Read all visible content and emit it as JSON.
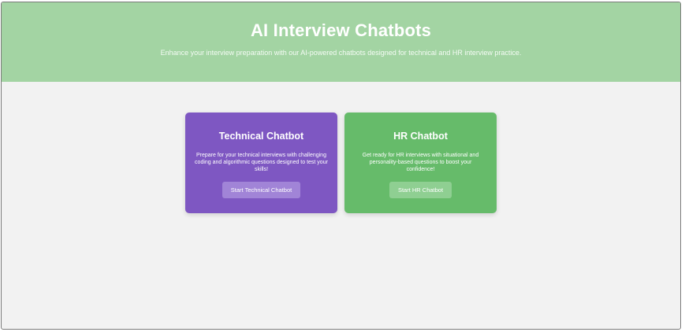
{
  "header": {
    "title": "AI Interview Chatbots",
    "subtitle": "Enhance your interview preparation with our AI-powered chatbots designed for technical and HR interview practice."
  },
  "cards": [
    {
      "title": "Technical Chatbot",
      "description": "Prepare for your technical interviews with challenging coding and algorithmic questions designed to test your skills!",
      "button_label": "Start Technical Chatbot",
      "color": "#7e57c2"
    },
    {
      "title": "HR Chatbot",
      "description": "Get ready for HR interviews with situational and personality-based questions to boost your confidence!",
      "button_label": "Start HR Chatbot",
      "color": "#66bb6a"
    }
  ],
  "colors": {
    "header_bg": "#a3d4a3",
    "page_bg": "#f2f2f2"
  }
}
